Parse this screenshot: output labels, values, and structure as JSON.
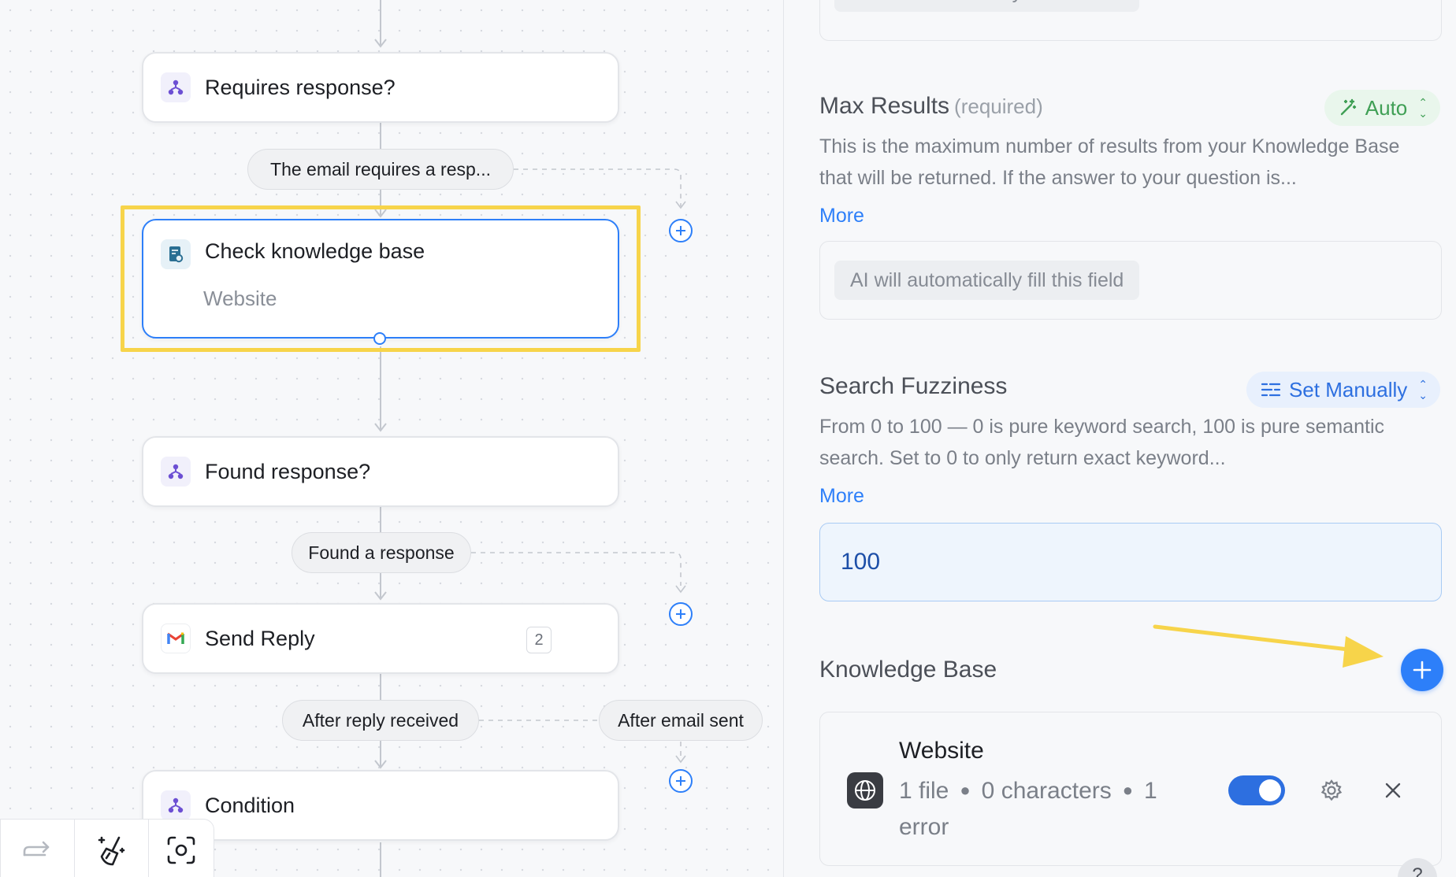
{
  "canvas": {
    "nodes": [
      {
        "id": "requires-response",
        "title": "Requires response?"
      },
      {
        "id": "check-knowledge-base",
        "title": "Check knowledge base",
        "subtitle": "Website"
      },
      {
        "id": "found-response",
        "title": "Found response?"
      },
      {
        "id": "send-reply",
        "title": "Send Reply",
        "badge": "2"
      },
      {
        "id": "condition",
        "title": "Condition"
      }
    ],
    "branch_labels": {
      "email_requires": "The email requires a resp...",
      "found_a_response": "Found a response",
      "after_reply_received": "After reply received",
      "after_email_sent": "After email sent"
    }
  },
  "panel": {
    "top_field": {
      "placeholder_chip": "AI will automatically fill this field"
    },
    "max_results": {
      "title": "Max Results",
      "required": "(required)",
      "mode": "Auto",
      "description": "This is the maximum number of results from your Knowledge Base that will be returned. If the answer to your question is...",
      "more": "More",
      "placeholder_chip": "AI will automatically fill this field"
    },
    "search_fuzziness": {
      "title": "Search Fuzziness",
      "mode": "Set Manually",
      "description": "From 0 to 100 — 0 is pure keyword search, 100 is pure semantic search. Set to 0 to only return exact keyword...",
      "more": "More",
      "value": "100"
    },
    "knowledge_base": {
      "title": "Knowledge Base",
      "items": [
        {
          "name": "Website",
          "files": "1 file",
          "characters": "0 characters",
          "errors": "1 error",
          "enabled": true
        }
      ]
    }
  },
  "colors": {
    "accent": "#2d7ff9",
    "highlight": "#f7d44a",
    "auto_green": "#3f9f55"
  }
}
